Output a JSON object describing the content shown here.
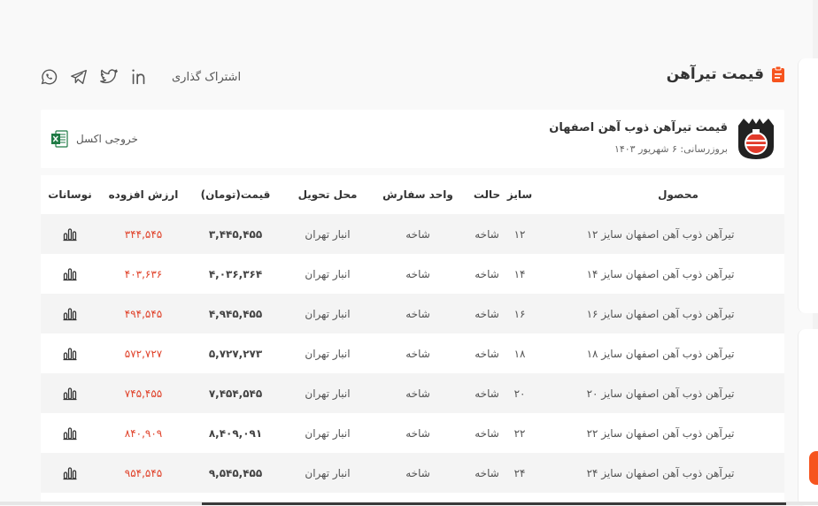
{
  "section": {
    "title": "قیمت تیرآهن",
    "accent": "#f6541e"
  },
  "share": {
    "label": "اشتراک گذاری",
    "icons": [
      "linkedin-icon",
      "twitter-icon",
      "telegram-icon",
      "whatsapp-icon"
    ]
  },
  "product": {
    "title": "قیمت تیرآهن ذوب آهن اصفهان",
    "updated": "بروزرسانی: ۶ شهریور ۱۴۰۳",
    "excel_label": "خروجی اکسل"
  },
  "table": {
    "headers": {
      "product": "محصول",
      "size": "سایز",
      "state": "حالت",
      "unit": "واحد سفارش",
      "location": "محل تحویل",
      "price": "قیمت(تومان)",
      "vat": "ارزش افزوده",
      "chart": "نوسانات"
    },
    "rows": [
      {
        "product": "تیرآهن ذوب آهن اصفهان سایز ۱۲",
        "size": "۱۲",
        "state": "شاخه",
        "unit": "شاخه",
        "location": "انبار تهران",
        "price": "۳,۴۴۵,۴۵۵",
        "vat": "۳۴۴,۵۴۵"
      },
      {
        "product": "تیرآهن ذوب آهن اصفهان سایز ۱۴",
        "size": "۱۴",
        "state": "شاخه",
        "unit": "شاخه",
        "location": "انبار تهران",
        "price": "۴,۰۳۶,۳۶۴",
        "vat": "۴۰۳,۶۳۶"
      },
      {
        "product": "تیرآهن ذوب آهن اصفهان سایز ۱۶",
        "size": "۱۶",
        "state": "شاخه",
        "unit": "شاخه",
        "location": "انبار تهران",
        "price": "۴,۹۴۵,۴۵۵",
        "vat": "۴۹۴,۵۴۵"
      },
      {
        "product": "تیرآهن ذوب آهن اصفهان سایز ۱۸",
        "size": "۱۸",
        "state": "شاخه",
        "unit": "شاخه",
        "location": "انبار تهران",
        "price": "۵,۷۲۷,۲۷۳",
        "vat": "۵۷۲,۷۲۷"
      },
      {
        "product": "تیرآهن ذوب آهن اصفهان سایز ۲۰",
        "size": "۲۰",
        "state": "شاخه",
        "unit": "شاخه",
        "location": "انبار تهران",
        "price": "۷,۴۵۴,۵۴۵",
        "vat": "۷۴۵,۴۵۵"
      },
      {
        "product": "تیرآهن ذوب آهن اصفهان سایز ۲۲",
        "size": "۲۲",
        "state": "شاخه",
        "unit": "شاخه",
        "location": "انبار تهران",
        "price": "۸,۴۰۹,۰۹۱",
        "vat": "۸۴۰,۹۰۹"
      },
      {
        "product": "تیرآهن ذوب آهن اصفهان سایز ۲۴",
        "size": "۲۴",
        "state": "شاخه",
        "unit": "شاخه",
        "location": "انبار تهران",
        "price": "۹,۵۴۵,۴۵۵",
        "vat": "۹۵۴,۵۴۵"
      }
    ]
  }
}
